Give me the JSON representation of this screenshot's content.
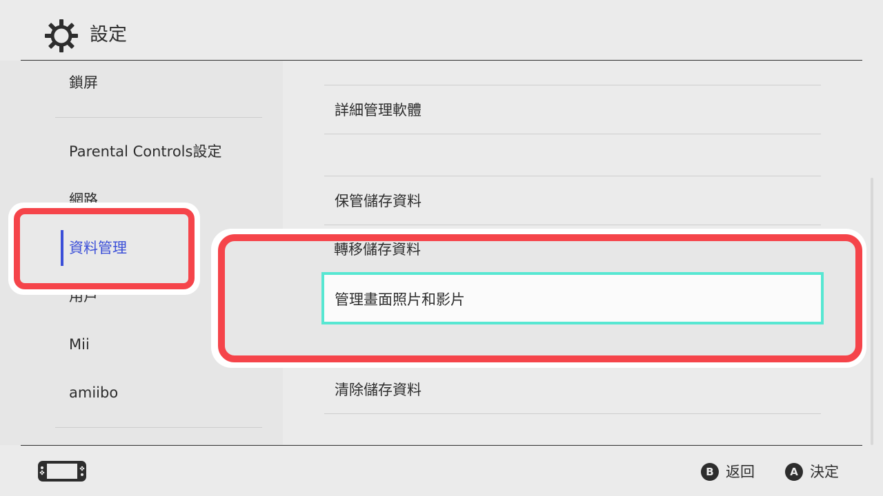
{
  "header": {
    "title": "設定",
    "icon": "gear-icon"
  },
  "sidebar": {
    "items": [
      {
        "label": "鎖屏"
      },
      {
        "label": "Parental Controls設定"
      },
      {
        "label": "網路"
      },
      {
        "label": "資料管理",
        "selected": true
      },
      {
        "label": "用戶"
      },
      {
        "label": "Mii"
      },
      {
        "label": "amiibo"
      }
    ]
  },
  "content": {
    "items": [
      {
        "label": "詳細管理軟體"
      },
      {
        "label": "保管儲存資料"
      },
      {
        "label": "轉移儲存資料"
      },
      {
        "label": "管理畫面照片和影片",
        "focused": true
      },
      {
        "label": "清除儲存資料"
      }
    ]
  },
  "footer": {
    "console_icon": "console-handheld-icon",
    "back": {
      "glyph": "B",
      "label": "返回"
    },
    "confirm": {
      "glyph": "A",
      "label": "決定"
    }
  },
  "colors": {
    "background": "#ebebeb",
    "accent": "#3b4fd8",
    "focus_outline": "#57e7d2",
    "highlight_red": "#f5444a"
  }
}
